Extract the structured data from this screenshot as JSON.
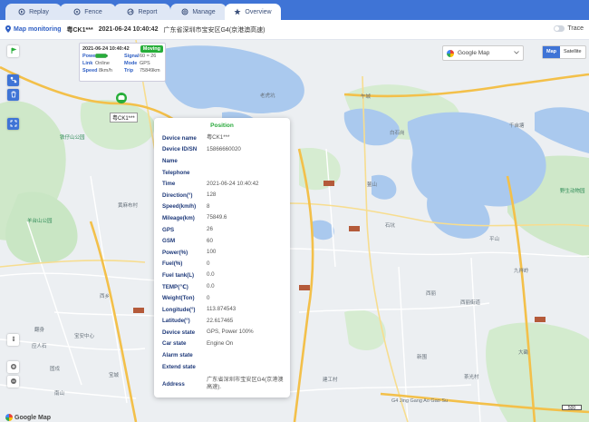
{
  "tabs": [
    {
      "label": "Replay",
      "icon": "replay-icon"
    },
    {
      "label": "Fence",
      "icon": "fence-icon"
    },
    {
      "label": "Report",
      "icon": "report-icon"
    },
    {
      "label": "Manage",
      "icon": "manage-icon"
    },
    {
      "label": "Overview",
      "icon": "star-icon"
    }
  ],
  "header": {
    "title": "Map monitoring",
    "plate": "粤CK1***",
    "datetime": "2021-06-24 10:40:42",
    "address": "广东省深圳市宝安区G4(京港澳高速)",
    "trace_label": "Trace"
  },
  "vehicle_popup": {
    "datetime": "2021-06-24 10:40:42",
    "status": "Moving",
    "power_label": "Power",
    "signal_label": "Signal",
    "signal_value": "60 ≈ 26",
    "link_label": "Link",
    "link_value": "Online",
    "mode_label": "Mode",
    "mode_value": "GPS",
    "speed_label": "Speed",
    "speed_value": "8km/h",
    "trip_label": "Trip",
    "trip_value": "75849km",
    "plate": "粤CK1***"
  },
  "info_panel": {
    "title": "Position",
    "rows": [
      {
        "label": "Device name",
        "value": "粤CK1***"
      },
      {
        "label": "Device ID/SN",
        "value": "15866660020"
      },
      {
        "label": "Name",
        "value": ""
      },
      {
        "label": "Telephone",
        "value": ""
      },
      {
        "label": "Time",
        "value": "2021-06-24 10:40:42"
      },
      {
        "label": "Direction(°)",
        "value": "128"
      },
      {
        "label": "Speed(km/h)",
        "value": "8"
      },
      {
        "label": "Mileage(km)",
        "value": "75849.6"
      },
      {
        "label": "GPS",
        "value": "26"
      },
      {
        "label": "GSM",
        "value": "60"
      },
      {
        "label": "Power(%)",
        "value": "100"
      },
      {
        "label": "Fuel(%)",
        "value": "0"
      },
      {
        "label": "Fuel tank(L)",
        "value": "0.0"
      },
      {
        "label": "TEMP(℃)",
        "value": "0.0"
      },
      {
        "label": "Weight(Ton)",
        "value": "0"
      },
      {
        "label": "Longitude(°)",
        "value": "113.874543"
      },
      {
        "label": "Latitude(°)",
        "value": "22.617465"
      },
      {
        "label": "Device state",
        "value": "GPS, Power 100%"
      },
      {
        "label": "Car state",
        "value": "Engine On"
      },
      {
        "label": "Alarm state",
        "value": ""
      },
      {
        "label": "Extend state",
        "value": ""
      },
      {
        "label": "Address",
        "value": "广东省深圳市宝安区G4(京港澳高速)."
      }
    ]
  },
  "map_controls": {
    "provider": "Google Map",
    "map_btn": "Map",
    "satellite_btn": "Satellite",
    "logo": "Google Map",
    "scale": "500"
  },
  "places": [
    "老虎坑",
    "午城",
    "白石岗",
    "鳌山",
    "石坑",
    "千亩塘",
    "野生动物园",
    "黄麻布村",
    "羊台山公园",
    "铁仔山公园",
    "西乡",
    "翻身",
    "宝安中心",
    "九祥岭",
    "西丽街道",
    "西丽",
    "建工村",
    "茶光村",
    "大磡",
    "新围",
    "G4 Jing Gang Ao Gao Su",
    "应人石",
    "固戍",
    "宝城",
    "平山",
    "南山"
  ],
  "colors": {
    "accent": "#3f74d6",
    "water": "#a9c8ee",
    "park": "#c9e6c4",
    "highway": "#f5c542",
    "status_green": "#27ae3a"
  }
}
